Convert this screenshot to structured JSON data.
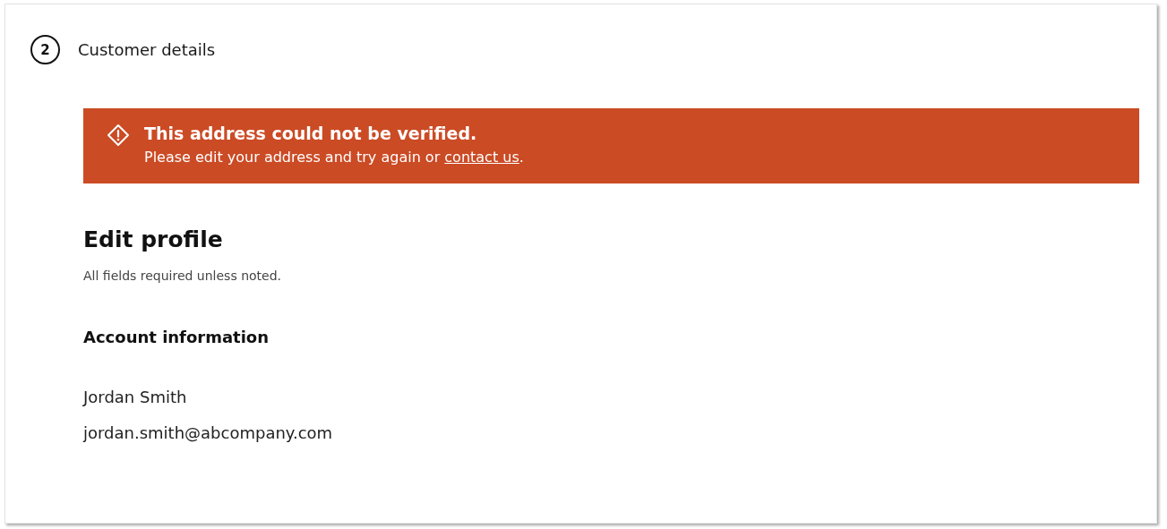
{
  "step": {
    "number": "2",
    "title": "Customer details"
  },
  "alert": {
    "kind": "error",
    "title": "This address could not be verified.",
    "message_before": "Please edit your address and try again or ",
    "link": "contact us",
    "message_after": "."
  },
  "heading": "Edit profile",
  "subtitle": "All fields required unless noted.",
  "section_title": "Account information",
  "account": {
    "name": "Jordan Smith",
    "email": "jordan.smith@abcompany.com"
  }
}
